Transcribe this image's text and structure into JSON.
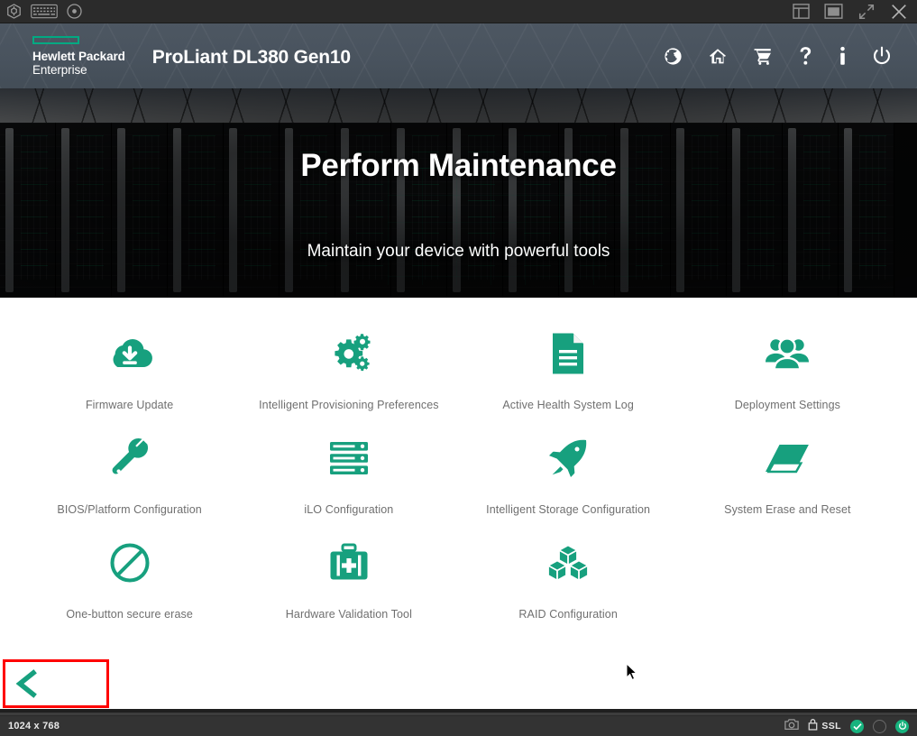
{
  "console": {
    "left_tools": [
      {
        "name": "virtual-media-icon",
        "title": "Virtual Media"
      },
      {
        "name": "keyboard-icon",
        "title": "Keyboard"
      },
      {
        "name": "virtual-disc-icon",
        "title": "Virtual Disc"
      }
    ],
    "right_tools": [
      {
        "name": "layout-icon",
        "title": "Layout"
      },
      {
        "name": "window-icon",
        "title": "Window"
      },
      {
        "name": "fullscreen-icon",
        "title": "Full Screen"
      },
      {
        "name": "close-icon",
        "title": "Close"
      }
    ]
  },
  "header": {
    "brand_line1": "Hewlett Packard",
    "brand_line2": "Enterprise",
    "product": "ProLiant DL380 Gen10",
    "accent_color": "#01a982",
    "background_color": "#49535e",
    "icons": [
      {
        "name": "globe-icon",
        "label": "Language"
      },
      {
        "name": "home-icon",
        "label": "Home"
      },
      {
        "name": "cart-icon",
        "label": "Cart"
      },
      {
        "name": "help-icon",
        "label": "Help"
      },
      {
        "name": "info-icon",
        "label": "Information"
      },
      {
        "name": "power-icon",
        "label": "Power"
      }
    ]
  },
  "hero": {
    "title": "Perform Maintenance",
    "subtitle": "Maintain your device with powerful tools"
  },
  "tiles": [
    {
      "label": "Firmware Update",
      "icon": "cloud-download-icon"
    },
    {
      "label": "Intelligent Provisioning Preferences",
      "icon": "gears-icon"
    },
    {
      "label": "Active Health System Log",
      "icon": "document-icon"
    },
    {
      "label": "Deployment Settings",
      "icon": "people-group-icon"
    },
    {
      "label": "BIOS/Platform Configuration",
      "icon": "wrench-icon"
    },
    {
      "label": "iLO Configuration",
      "icon": "server-stack-icon"
    },
    {
      "label": "Intelligent Storage Configuration",
      "icon": "rocket-icon"
    },
    {
      "label": "System Erase and Reset",
      "icon": "eraser-icon"
    },
    {
      "label": "One-button secure erase",
      "icon": "prohibited-icon"
    },
    {
      "label": "Hardware Validation Tool",
      "icon": "first-aid-kit-icon"
    },
    {
      "label": "RAID Configuration",
      "icon": "cubes-icon"
    }
  ],
  "navigation": {
    "back_label": "Back",
    "annotation_color": "#ff0000",
    "icon_color": "#17a07e"
  },
  "status": {
    "resolution": "1024 x 768",
    "ssl_label": "SSL",
    "indicators": [
      {
        "name": "camera-icon",
        "state": "idle"
      },
      {
        "name": "lock-icon",
        "state": "secure"
      },
      {
        "name": "health-ok-indicator",
        "state": "ok"
      },
      {
        "name": "uid-indicator",
        "state": "off"
      },
      {
        "name": "power-indicator",
        "state": "on"
      }
    ]
  },
  "tile_colors": {
    "icon": "#17a07e",
    "label": "#6f6f6f"
  }
}
